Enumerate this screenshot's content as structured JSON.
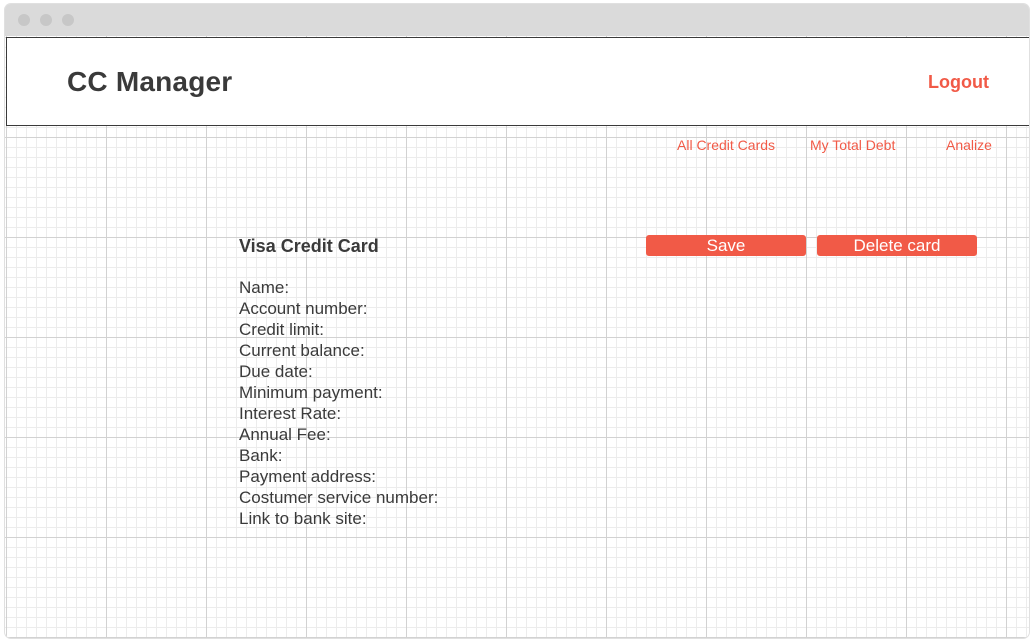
{
  "window": {
    "controls": [
      "close-dot",
      "minimize-dot",
      "zoom-dot"
    ]
  },
  "header": {
    "app_title": "CC Manager",
    "logout_label": "Logout"
  },
  "nav": {
    "items": [
      {
        "label": "All Credit Cards"
      },
      {
        "label": "My Total Debt"
      },
      {
        "label": "Analize"
      }
    ]
  },
  "card": {
    "title": "Visa Credit Card",
    "save_label": "Save",
    "delete_label": "Delete card",
    "fields": [
      {
        "label": "Name:"
      },
      {
        "label": "Account number:"
      },
      {
        "label": "Credit limit:"
      },
      {
        "label": "Current balance:"
      },
      {
        "label": "Due date:"
      },
      {
        "label": "Minimum payment:"
      },
      {
        "label": "Interest Rate:"
      },
      {
        "label": "Annual Fee:"
      },
      {
        "label": "Bank:"
      },
      {
        "label": "Payment address:"
      },
      {
        "label": "Costumer service number:"
      },
      {
        "label": "Link to bank site:"
      }
    ]
  },
  "colors": {
    "accent": "#f15a47",
    "text": "#3a3a3a",
    "titlebar": "#dadada",
    "grid_major": "#d2d2d2",
    "grid_minor": "#ececec"
  }
}
